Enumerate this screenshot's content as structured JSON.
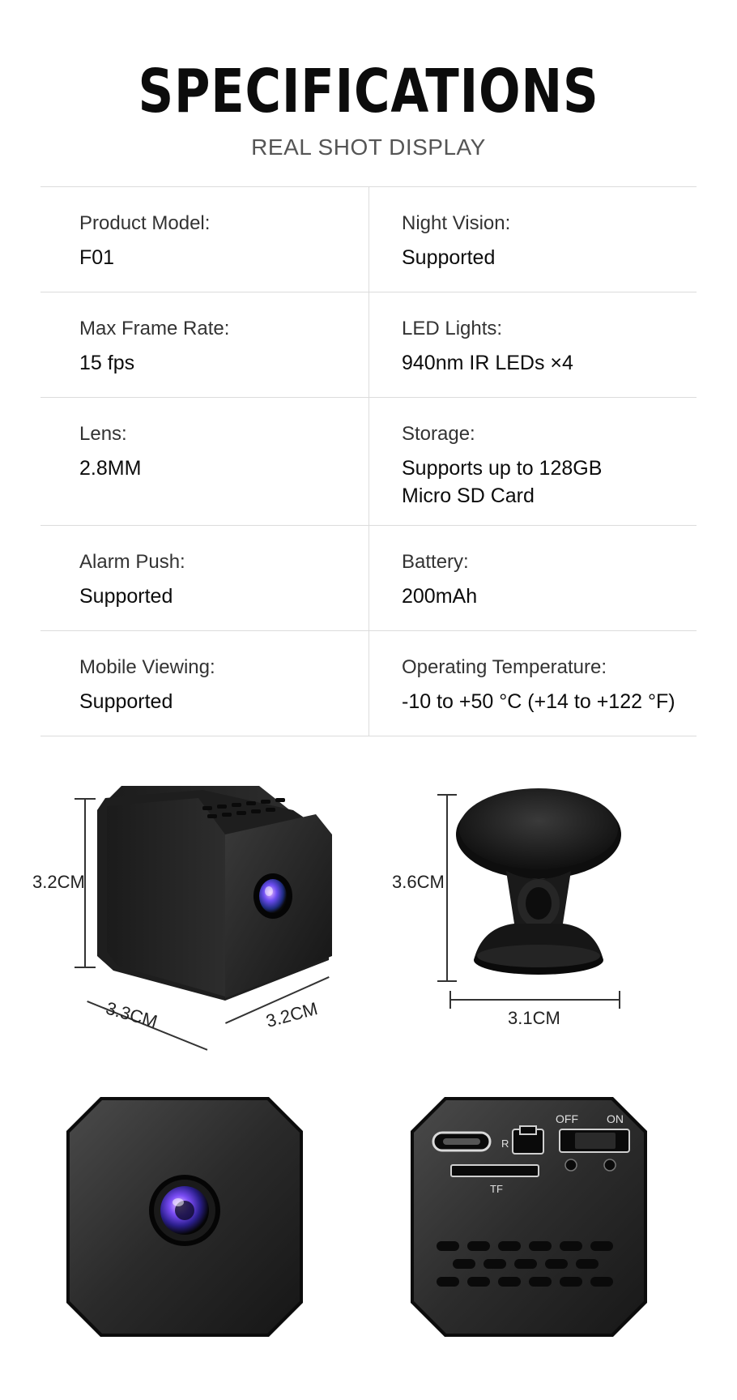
{
  "header": {
    "title": "SPECIFICATIONS",
    "subtitle": "REAL SHOT DISPLAY"
  },
  "specs": [
    {
      "left": {
        "label": "Product Model:",
        "value": "F01"
      },
      "right": {
        "label": "Night Vision:",
        "value": "Supported"
      }
    },
    {
      "left": {
        "label": "Max Frame Rate:",
        "value": "15 fps"
      },
      "right": {
        "label": "LED Lights:",
        "value": "940nm IR LEDs ×4"
      }
    },
    {
      "left": {
        "label": "Lens:",
        "value": "2.8MM"
      },
      "right": {
        "label": "Storage:",
        "value": "Supports up to 128GB",
        "value2": "Micro SD Card"
      }
    },
    {
      "left": {
        "label": "Alarm Push:",
        "value": "Supported"
      },
      "right": {
        "label": "Battery:",
        "value": "200mAh"
      }
    },
    {
      "left": {
        "label": "Mobile Viewing:",
        "value": "Supported"
      },
      "right": {
        "label": "Operating Temperature:",
        "value": "-10 to +50 °C (+14 to +122 °F)"
      }
    }
  ],
  "camera_dimensions": {
    "height": "3.2CM",
    "depth": "3.3CM",
    "width": "3.2CM"
  },
  "mount_dimensions": {
    "height": "3.6CM",
    "width": "3.1CM"
  },
  "back_panel": {
    "switch_off": "OFF",
    "switch_on": "ON",
    "reset": "R",
    "card_slot": "TF"
  }
}
